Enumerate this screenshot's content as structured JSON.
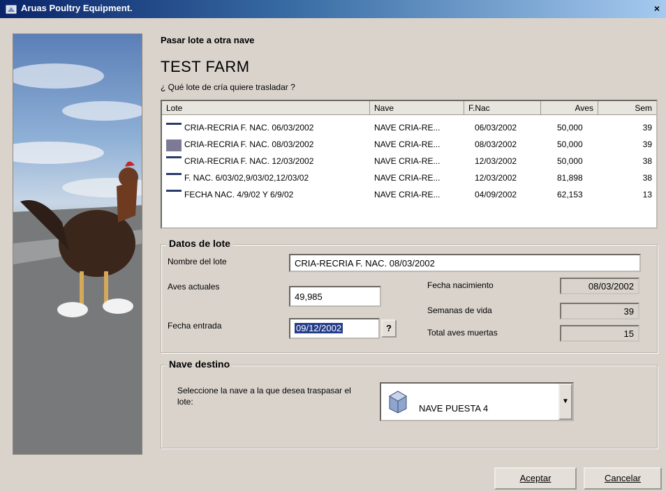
{
  "window": {
    "title": "Aruas Poultry Equipment."
  },
  "page": {
    "heading": "Pasar lote a otra nave",
    "farm_name": "TEST FARM",
    "question": "¿ Qué lote de cría quiere trasladar ?"
  },
  "lot_list": {
    "columns": [
      "Lote",
      "Nave",
      "F.Nac",
      "Aves",
      "Sem"
    ],
    "rows": [
      {
        "lote": "CRIA-RECRIA F. NAC. 06/03/2002",
        "nave": "NAVE CRIA-RE...",
        "fnac": "06/03/2002",
        "aves": "50,000",
        "sem": "39"
      },
      {
        "lote": "CRIA-RECRIA F. NAC. 08/03/2002",
        "nave": "NAVE CRIA-RE...",
        "fnac": "08/03/2002",
        "aves": "50,000",
        "sem": "39",
        "selected": true
      },
      {
        "lote": "CRIA-RECRIA F. NAC. 12/03/2002",
        "nave": "NAVE CRIA-RE...",
        "fnac": "12/03/2002",
        "aves": "50,000",
        "sem": "38"
      },
      {
        "lote": "F. NAC. 6/03/02,9/03/02,12/03/02",
        "nave": "NAVE CRIA-RE...",
        "fnac": "12/03/2002",
        "aves": "81,898",
        "sem": "38"
      },
      {
        "lote": "FECHA NAC. 4/9/02 Y 6/9/02",
        "nave": "NAVE CRIA-RE...",
        "fnac": "04/09/2002",
        "aves": "62,153",
        "sem": "13"
      }
    ]
  },
  "datos_lote": {
    "group_label": "Datos de lote",
    "nombre_label": "Nombre del lote",
    "nombre_value": "CRIA-RECRIA F. NAC. 08/03/2002",
    "aves_label": "Aves actuales",
    "aves_value": "49,985",
    "fecha_entrada_label": "Fecha entrada",
    "fecha_entrada_value": "09/12/2002",
    "help_button": "?",
    "fecha_nac_label": "Fecha nacimiento",
    "fecha_nac_value": "08/03/2002",
    "semanas_label": "Semanas de vida",
    "semanas_value": "39",
    "muertes_label": "Total aves muertas",
    "muertes_value": "15"
  },
  "nave_destino": {
    "group_label": "Nave destino",
    "instruction": "Seleccione la nave a la que desea traspasar el lote:",
    "selected": "NAVE PUESTA 4"
  },
  "buttons": {
    "accept": "Aceptar",
    "cancel": "Cancelar"
  }
}
